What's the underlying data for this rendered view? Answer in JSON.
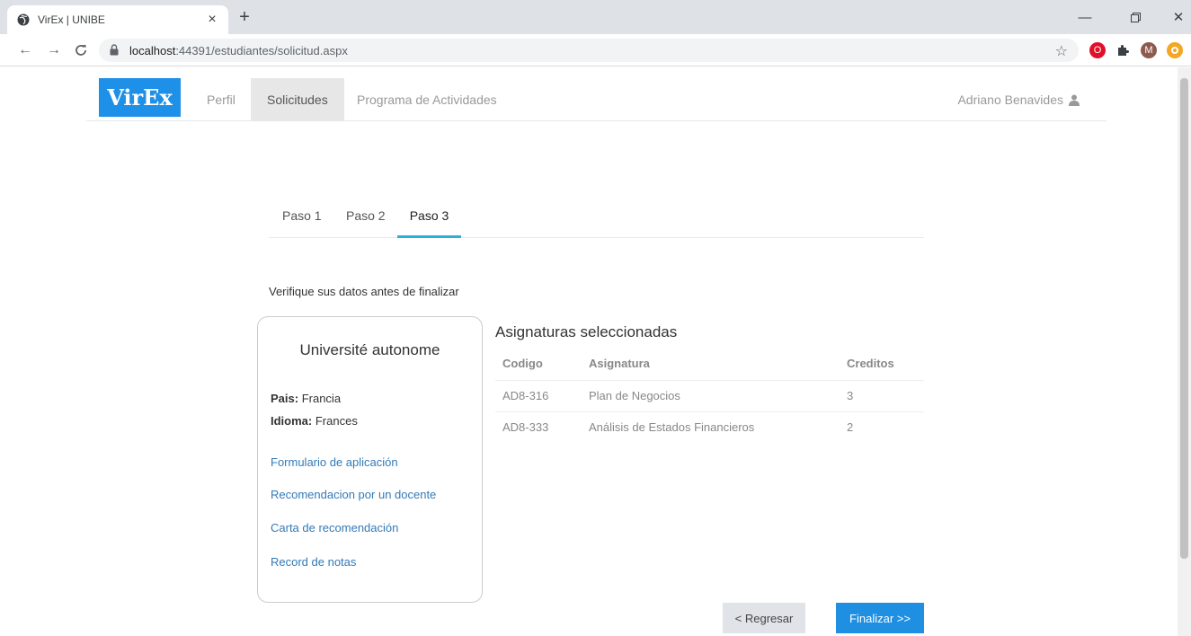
{
  "browser": {
    "tab_title": "VirEx | UNIBE",
    "url_host": "localhost",
    "url_rest": ":44391/estudiantes/solicitud.aspx",
    "profile_initial": "M"
  },
  "navbar": {
    "brand": "VirEx",
    "links": [
      "Perfil",
      "Solicitudes",
      "Programa de Actividades"
    ],
    "active_link": "Solicitudes",
    "user_name": "Adriano Benavides"
  },
  "steps": {
    "items": [
      "Paso 1",
      "Paso 2",
      "Paso 3"
    ],
    "active": "Paso 3"
  },
  "verify_text": "Verifique sus datos antes de finalizar",
  "university": {
    "name": "Université autonome",
    "country_label": "Pais:",
    "country_value": "Francia",
    "language_label": "Idioma:",
    "language_value": "Frances",
    "links": [
      "Formulario de aplicación",
      "Recomendacion por un docente",
      "Carta de recomendación",
      "Record de notas"
    ]
  },
  "subjects": {
    "title": "Asignaturas seleccionadas",
    "headers": [
      "Codigo",
      "Asignatura",
      "Creditos"
    ],
    "rows": [
      [
        "AD8-316",
        "Plan de Negocios",
        "3"
      ],
      [
        "AD8-333",
        "Análisis de Estados Financieros",
        "2"
      ]
    ]
  },
  "buttons": {
    "back": "< Regresar",
    "finish": "Finalizar >>"
  },
  "colors": {
    "brand": "#1e90e8",
    "step_accent": "#29b2d4",
    "link": "#337ab7",
    "finish_button": "#1e8fe1"
  }
}
